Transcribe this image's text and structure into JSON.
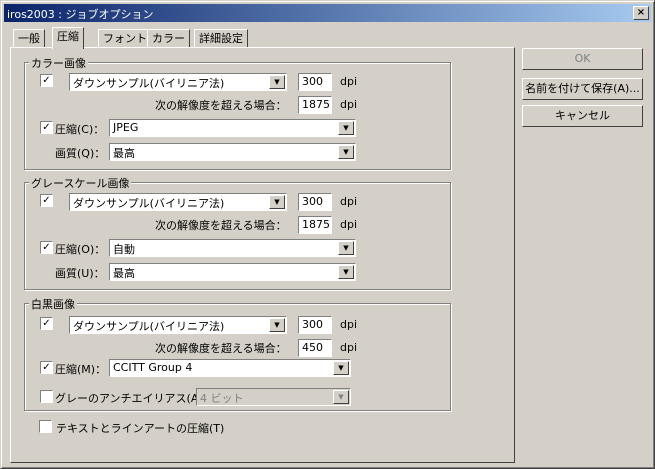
{
  "window": {
    "title": "iros2003 : ジョブオプション",
    "close": "×"
  },
  "tabs": [
    "一般",
    "圧縮",
    "フォント",
    "カラー",
    "詳細設定"
  ],
  "buttons": {
    "ok": "OK",
    "save_as": "名前を付けて保存(A)...",
    "cancel": "キャンセル"
  },
  "color_images": {
    "title": "カラー画像",
    "downsample": {
      "checked": true,
      "method": "ダウンサンプル(バイリニア法)",
      "dpi": "300",
      "unit": "dpi"
    },
    "threshold_label": "次の解像度を超える場合：",
    "threshold": "1875",
    "compression": {
      "checked": true,
      "label": "圧縮(C)：",
      "value": "JPEG"
    },
    "quality": {
      "label": "画質(Q)：",
      "value": "最高"
    }
  },
  "gray_images": {
    "title": "グレースケール画像",
    "downsample": {
      "checked": true,
      "method": "ダウンサンプル(バイリニア法)",
      "dpi": "300",
      "unit": "dpi"
    },
    "threshold_label": "次の解像度を超える場合：",
    "threshold": "1875",
    "compression": {
      "checked": true,
      "label": "圧縮(O)：",
      "value": "自動"
    },
    "quality": {
      "label": "画質(U)：",
      "value": "最高"
    }
  },
  "mono_images": {
    "title": "白黒画像",
    "downsample": {
      "checked": true,
      "method": "ダウンサンプル(バイリニア法)",
      "dpi": "300",
      "unit": "dpi"
    },
    "threshold_label": "次の解像度を超える場合：",
    "threshold": "450",
    "compression": {
      "checked": true,
      "label": "圧縮(M)：",
      "value": "CCITT Group 4"
    },
    "antialias": {
      "checked": false,
      "label": "グレーのアンチエイリアス(A)",
      "value": "4 ビット"
    }
  },
  "compress_text": {
    "checked": false,
    "label": "テキストとラインアートの圧縮(T)"
  },
  "check_mark": "✓",
  "arrow": "▼"
}
